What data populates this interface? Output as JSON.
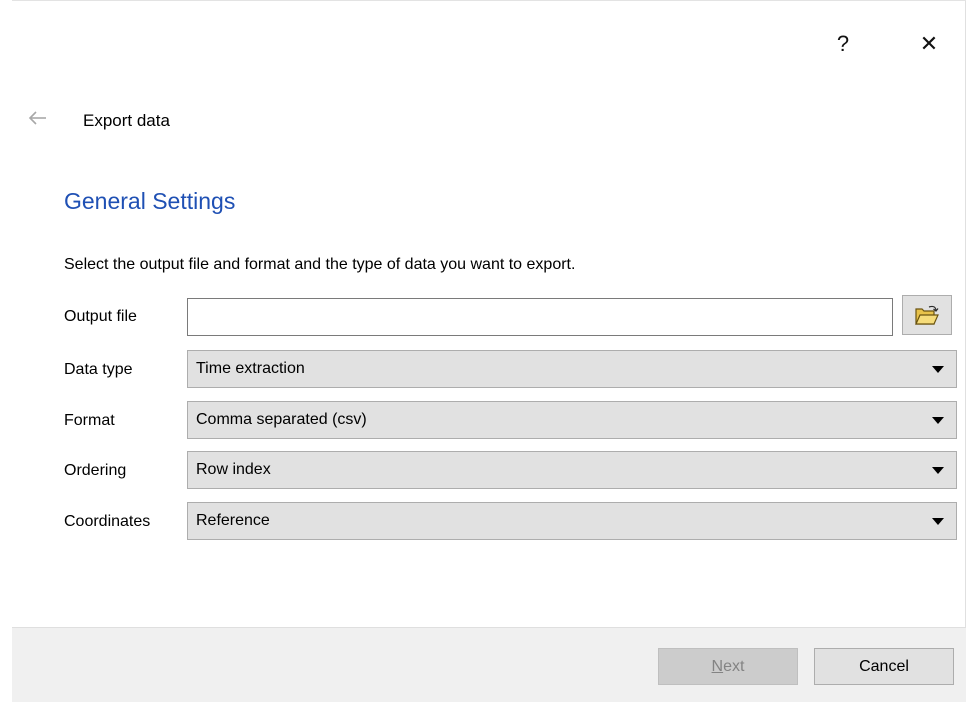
{
  "titlebar": {
    "help_label": "?",
    "close_label": "✕"
  },
  "header": {
    "back_icon": "arrow-left-icon",
    "title": "Export data"
  },
  "section": {
    "title": "General Settings",
    "instruction": "Select the output file and format and the type of data you want to export."
  },
  "form": {
    "output_file": {
      "label": "Output file",
      "value": "",
      "browse_icon": "open-folder-icon"
    },
    "data_type": {
      "label": "Data type",
      "value": "Time extraction"
    },
    "format": {
      "label": "Format",
      "value": "Comma separated (csv)"
    },
    "ordering": {
      "label": "Ordering",
      "value": "Row index"
    },
    "coordinates": {
      "label": "Coordinates",
      "value": "Reference"
    }
  },
  "footer": {
    "next": {
      "mnemonic": "N",
      "rest": "ext",
      "enabled": false
    },
    "cancel_label": "Cancel"
  },
  "colors": {
    "section_title": "#1f50b4",
    "button_face": "#e1e1e1",
    "footer_bg": "#f0f0f0",
    "disabled_text": "#838383"
  }
}
